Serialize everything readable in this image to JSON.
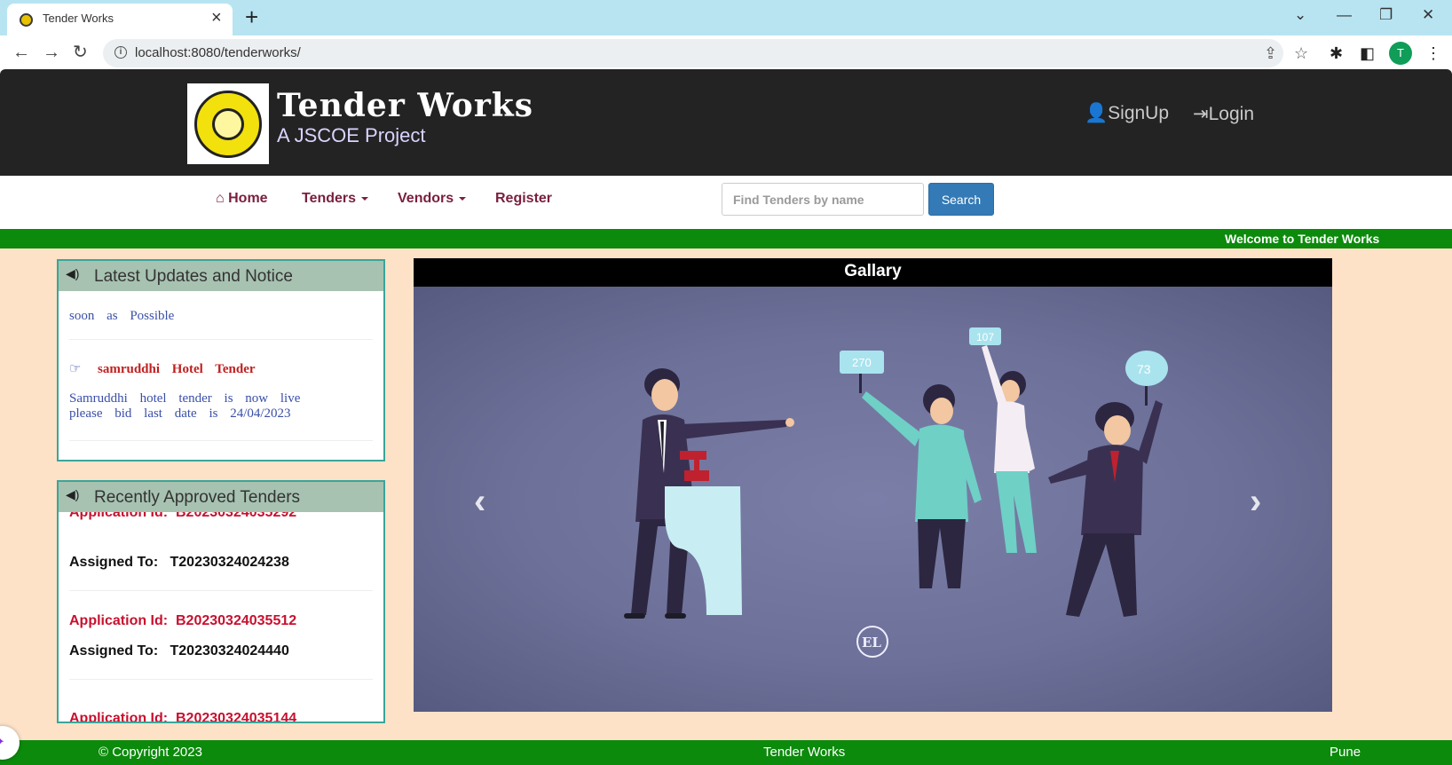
{
  "browser": {
    "tab_title": "Tender Works",
    "tab_close": "×",
    "new_tab": "+",
    "url": "localhost:8080/tenderworks/",
    "avatar_letter": "T"
  },
  "header": {
    "brand_title": "Tender Works",
    "brand_subtitle": "A JSCOE Project",
    "signup_label": "SignUp",
    "login_label": "Login"
  },
  "nav": {
    "home": "Home",
    "tenders": "Tenders",
    "vendors": "Vendors",
    "register": "Register",
    "search_placeholder": "Find Tenders by name",
    "search_button": "Search"
  },
  "marquee": {
    "text": "Welcome to Tender Works"
  },
  "notices": {
    "title": "Latest Updates and Notice",
    "soon_text": "soon as Possible",
    "tender_title": "samruddhi Hotel Tender",
    "tender_text": "Samruddhi hotel tender is now live please bid last date is 24/04/2023"
  },
  "approved": {
    "title": "Recently Approved Tenders",
    "app_label": "Application Id:",
    "assigned_label": "Assigned To:",
    "items": [
      {
        "application_id": "B20230324035292",
        "assigned_to": "T20230324024238"
      },
      {
        "application_id": "B20230324035512",
        "assigned_to": "T20230324024440"
      },
      {
        "application_id": "B20230324035144",
        "assigned_to": ""
      }
    ]
  },
  "gallery": {
    "title": "Gallary",
    "sign_1": "270",
    "sign_2": "107",
    "sign_3": "73",
    "watermark": "EL"
  },
  "footer": {
    "copyright": "© Copyright 2023",
    "center": "Tender Works",
    "location": "Pune"
  },
  "colors": {
    "header_bg": "#232323",
    "nav_link": "#7a1f3d",
    "green_bar": "#0c8a0c",
    "main_bg": "#fde2c8",
    "search_button": "#337ab7"
  }
}
